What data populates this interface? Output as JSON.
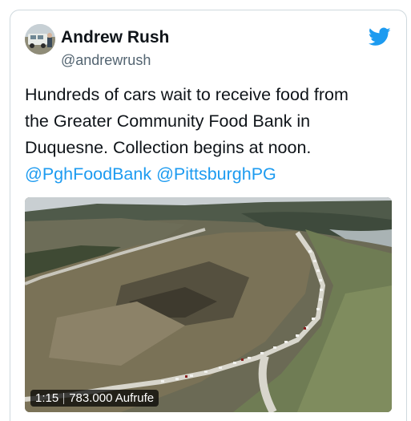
{
  "tweet": {
    "author_name": "Andrew Rush",
    "author_handle": "@andrewrush",
    "text_lines": [
      "Hundreds of cars wait to receive food from",
      "the Greater Community Food Bank in",
      "Duquesne. Collection begins at noon."
    ],
    "mentions": [
      "@PghFoodBank",
      "@PittsburghPG"
    ]
  },
  "video": {
    "duration": "1:15",
    "views": "783.000 Aufrufe"
  },
  "icons": {
    "brand": "twitter-bird-icon"
  },
  "colors": {
    "link": "#1d9bf0",
    "twitter_blue": "#1d9bf0",
    "text": "#0f1419",
    "secondary": "#536471",
    "border": "#cfd9de"
  }
}
